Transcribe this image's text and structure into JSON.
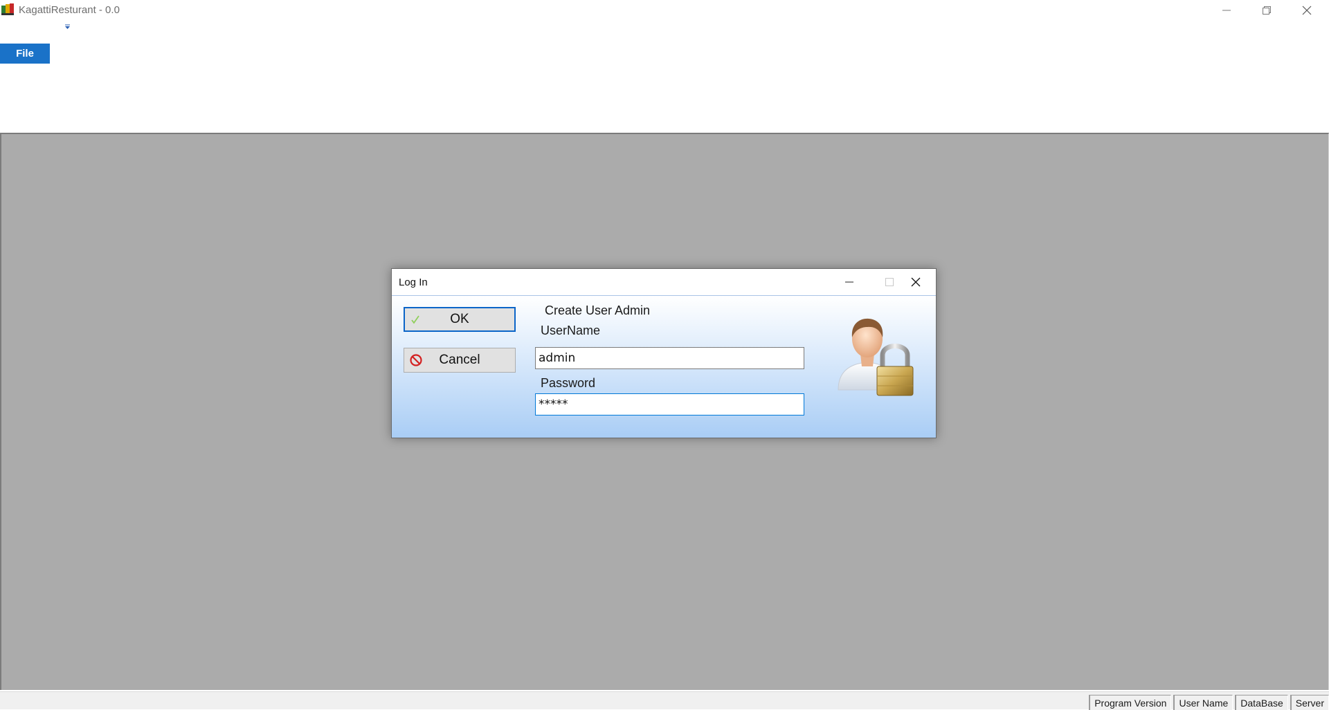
{
  "window": {
    "title": "KagattiResturant - 0.0",
    "controls": [
      "minimize-icon",
      "restore-icon",
      "close-icon"
    ]
  },
  "ribbon": {
    "file_tab": "File"
  },
  "dialog": {
    "title": "Log In",
    "heading": "Create User Admin",
    "username_label": "UserName",
    "username_value": "admin",
    "password_label": "Password",
    "password_value": "*****",
    "ok_label": "OK",
    "cancel_label": "Cancel",
    "image": "user-lock-icon"
  },
  "statusbar": {
    "panels": [
      "Program Version",
      "User Name",
      "DataBase",
      "Server"
    ]
  },
  "colors": {
    "file_tab": "#1a72c8",
    "mdi_background": "#ababab",
    "dialog_gradient_bottom": "#a9cdf5",
    "focus_border": "#0a64c8"
  }
}
